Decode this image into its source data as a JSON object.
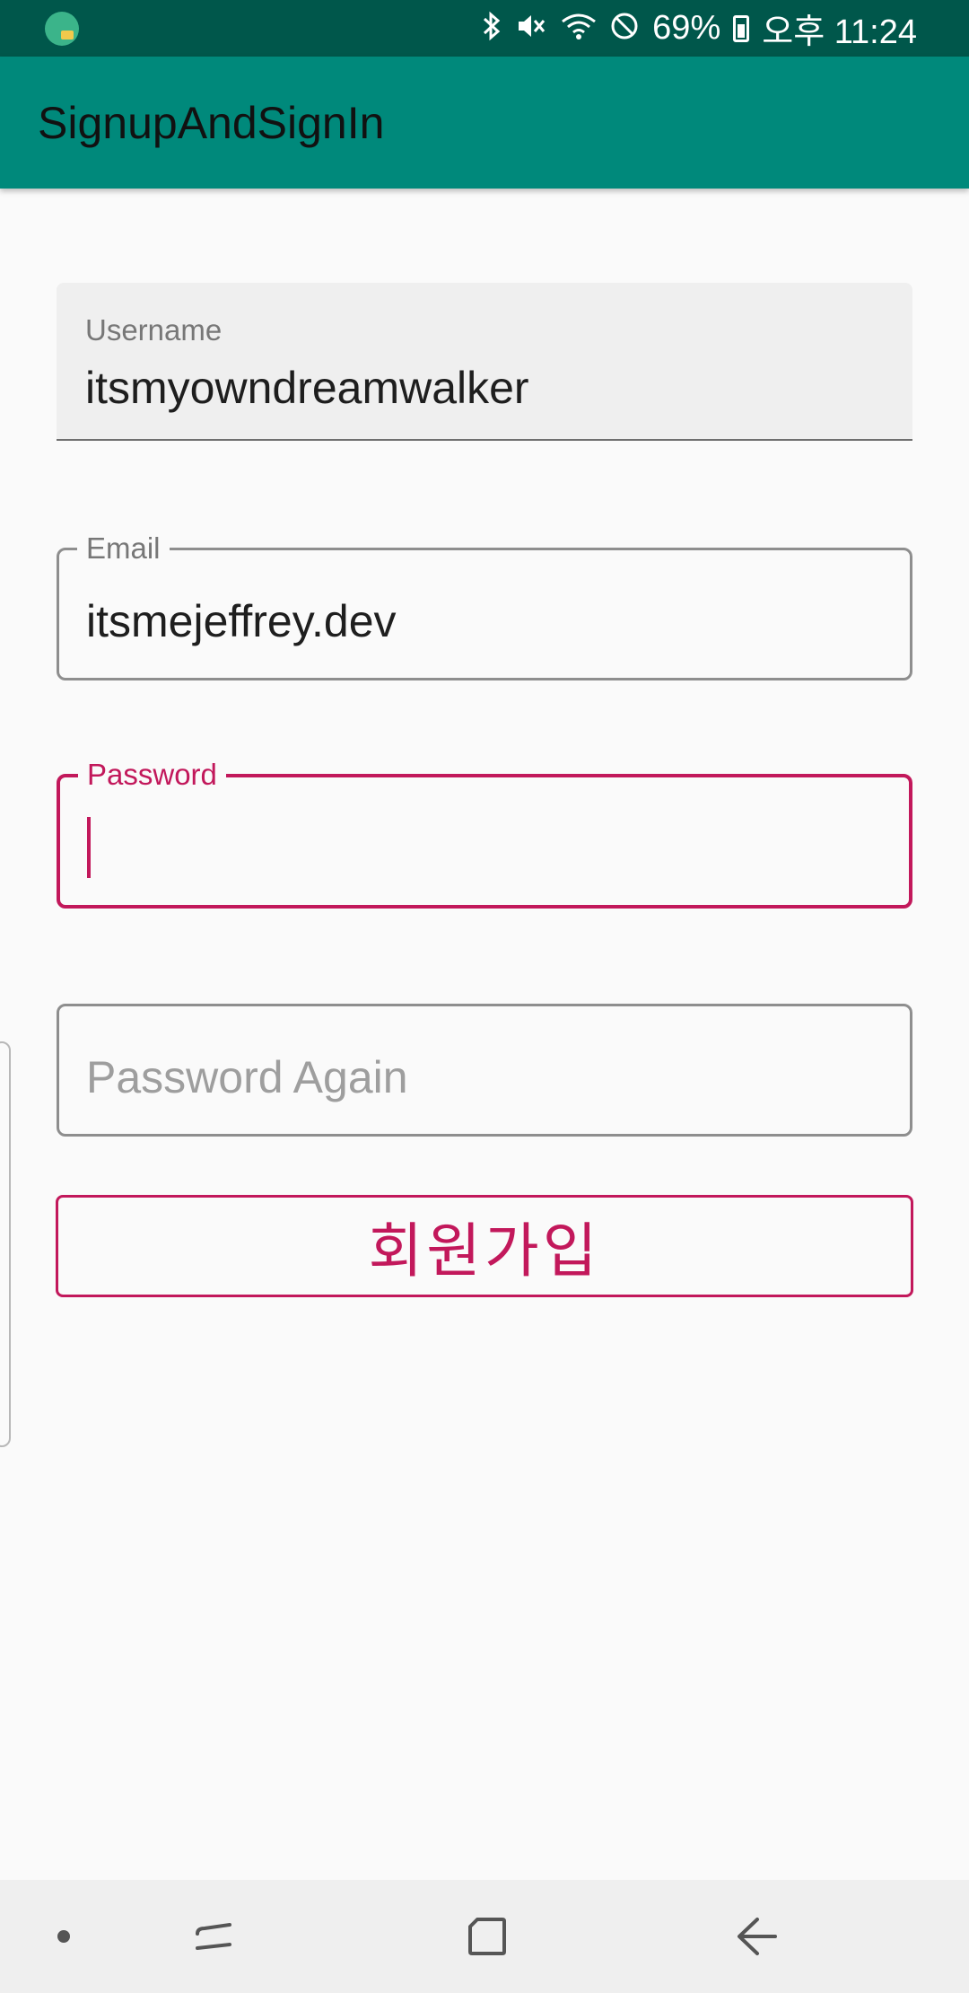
{
  "status_bar": {
    "battery": "69%",
    "time": "오후 11:24",
    "icons": [
      "app-notification-icon",
      "bluetooth-icon",
      "mute-icon",
      "wifi-icon",
      "do-not-disturb-icon",
      "battery-icon"
    ]
  },
  "app_bar": {
    "title": "SignupAndSignIn"
  },
  "form": {
    "username": {
      "label": "Username",
      "value": "itsmyowndreamwalker"
    },
    "email": {
      "label": "Email",
      "value": "itsmejeffrey.dev"
    },
    "password": {
      "label": "Password",
      "value": ""
    },
    "password_again": {
      "placeholder": "Password Again"
    },
    "signup_label": "회원가입"
  },
  "colors": {
    "status_bar": "#00574b",
    "app_bar": "#00897b",
    "accent": "#c2185b"
  },
  "nav_bar": {
    "icons": [
      "dot-icon",
      "recent-apps-icon",
      "home-icon",
      "back-icon"
    ]
  }
}
